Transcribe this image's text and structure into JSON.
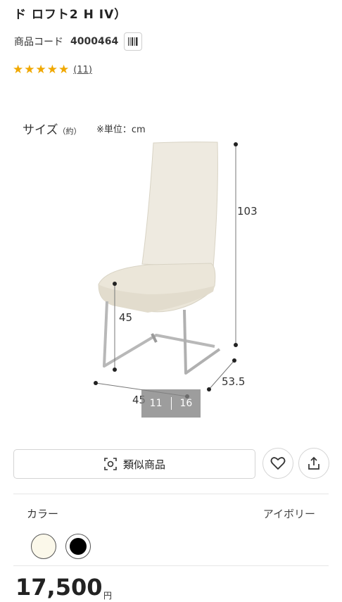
{
  "product": {
    "title": "ド ロフト2 H IV）",
    "code_label": "商品コード",
    "code_value": "4000464",
    "rating_stars": 5,
    "review_count": "(11)"
  },
  "image": {
    "size_label": "サイズ",
    "size_approx": "（約）",
    "unit_note": "※単位：cm",
    "dim_height": "103",
    "dim_seat": "45",
    "dim_width": "45",
    "dim_depth": "53.5",
    "pager_current": "11",
    "pager_total": "16",
    "chair_color": "#eeeae0",
    "leg_color": "#b8b8b8"
  },
  "actions": {
    "similar_label": "類似商品",
    "favorite_icon": "heart-icon",
    "share_icon": "share-icon"
  },
  "color_section": {
    "label": "カラー",
    "selected": "アイボリー",
    "options": [
      {
        "name": "ivory",
        "hex": "#fbf8ea"
      },
      {
        "name": "black",
        "hex": "#000000"
      }
    ]
  },
  "price": {
    "amount": "17,500",
    "currency": "円"
  }
}
